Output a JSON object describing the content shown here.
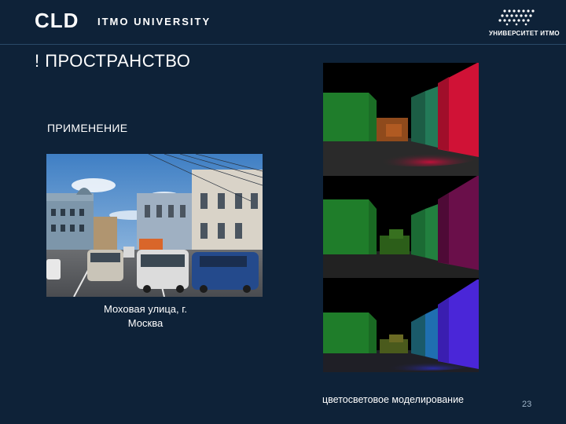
{
  "header": {
    "logo_cld": "CLD",
    "logo_itmo": "ITMO UNIVERSITY",
    "university_label": "УНИВЕРСИТЕТ ИТМО"
  },
  "slide": {
    "title": "! ПРОСТРАНСТВО",
    "subtitle": "ПРИМЕНЕНИЕ",
    "photo_caption": "Моховая улица, г. Москва",
    "render_caption": "цветосветовое моделирование",
    "page_number": "23"
  }
}
